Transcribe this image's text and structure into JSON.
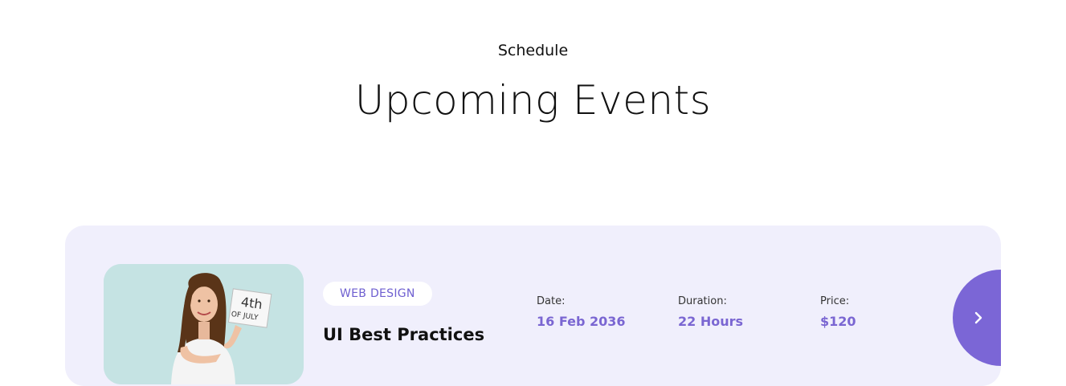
{
  "header": {
    "eyebrow": "Schedule",
    "title": "Upcoming Events"
  },
  "event": {
    "tag": "WEB DESIGN",
    "title": "UI Best Practices",
    "sign_text_line1": "4th",
    "sign_text_line2": "OF JULY",
    "meta": {
      "date_label": "Date:",
      "date_value": "16 Feb 2036",
      "duration_label": "Duration:",
      "duration_value": "22 Hours",
      "price_label": "Price:",
      "price_value": "$120"
    },
    "next_icon": "chevron-right-icon"
  },
  "colors": {
    "accent": "#7b66d6",
    "card_bg": "#f0effc",
    "photo_bg": "#c5e3e3"
  }
}
